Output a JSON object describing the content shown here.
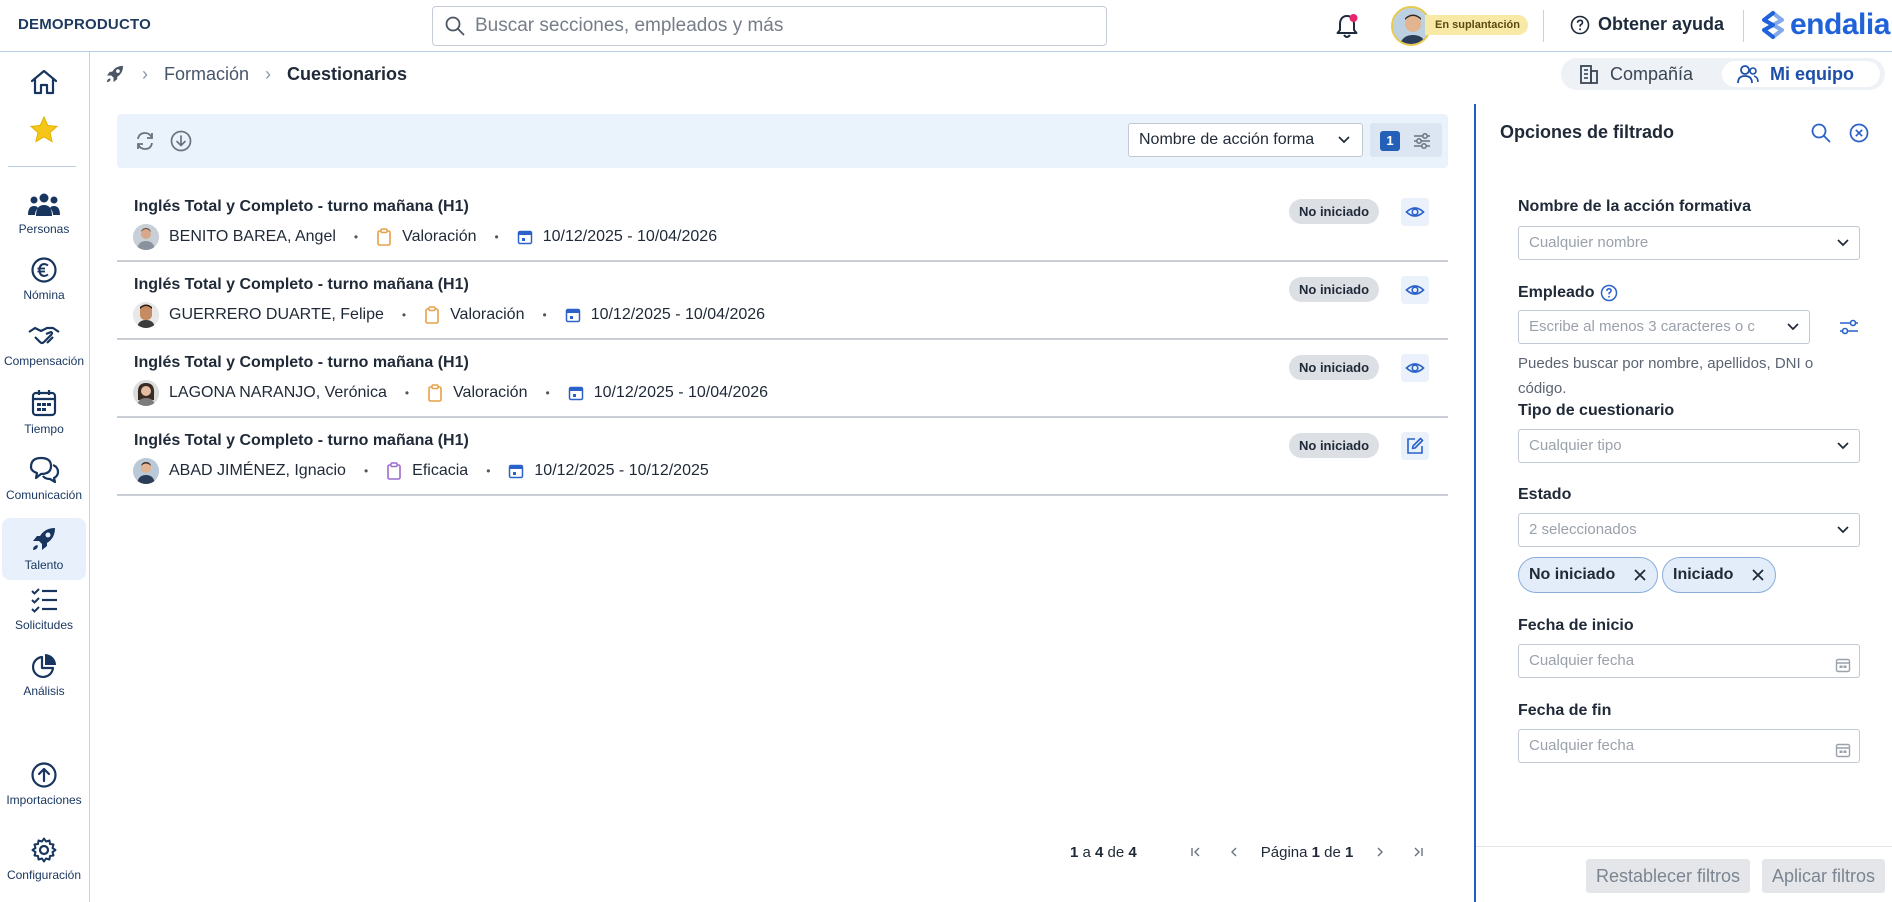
{
  "header": {
    "company": "DEMOPRODUCTO",
    "search_placeholder": "Buscar secciones, empleados y más",
    "impersonation": "En suplantación",
    "help": "Obtener ayuda",
    "logo": "endalia"
  },
  "sidebar": {
    "items": [
      {
        "label": "",
        "icon": "home-icon"
      },
      {
        "label": "",
        "icon": "star-icon"
      },
      {
        "label": "Personas",
        "icon": "people-icon"
      },
      {
        "label": "Nómina",
        "icon": "euro-icon"
      },
      {
        "label": "Compensación",
        "icon": "handshake-icon"
      },
      {
        "label": "Tiempo",
        "icon": "calendar-icon"
      },
      {
        "label": "Comunicación",
        "icon": "chat-icon"
      },
      {
        "label": "Talento",
        "icon": "rocket-icon"
      },
      {
        "label": "Solicitudes",
        "icon": "checklist-icon"
      },
      {
        "label": "Análisis",
        "icon": "pie-chart-icon"
      },
      {
        "label": "Importaciones",
        "icon": "import-icon"
      },
      {
        "label": "Configuración",
        "icon": "gear-icon"
      }
    ]
  },
  "breadcrumb": {
    "items": [
      "Formación",
      "Cuestionarios"
    ]
  },
  "view_switch": {
    "company": "Compañía",
    "team": "Mi equipo"
  },
  "toolbar": {
    "select_label": "Nombre de acción forma",
    "filter_count": "1"
  },
  "rows": [
    {
      "title": "Inglés Total y Completo - turno mañana (H1)",
      "employee": "BENITO BAREA, Angel",
      "type": "Valoración",
      "dates": "10/12/2025 - 10/04/2026",
      "status": "No iniciado",
      "action": "view"
    },
    {
      "title": "Inglés Total y Completo - turno mañana (H1)",
      "employee": "GUERRERO DUARTE, Felipe",
      "type": "Valoración",
      "dates": "10/12/2025 - 10/04/2026",
      "status": "No iniciado",
      "action": "view"
    },
    {
      "title": "Inglés Total y Completo - turno mañana (H1)",
      "employee": "LAGONA NARANJO, Verónica",
      "type": "Valoración",
      "dates": "10/12/2025 - 10/04/2026",
      "status": "No iniciado",
      "action": "view"
    },
    {
      "title": "Inglés Total y Completo - turno mañana (H1)",
      "employee": "ABAD JIMÉNEZ, Ignacio",
      "type": "Eficacia",
      "dates": "10/12/2025 - 10/12/2025",
      "status": "No iniciado",
      "action": "edit"
    }
  ],
  "pager": {
    "from": "1",
    "a": "a",
    "to": "4",
    "de": "de",
    "total": "4",
    "page_word": "Página",
    "page": "1",
    "page_of": "de",
    "pages": "1"
  },
  "filters": {
    "title": "Opciones de filtrado",
    "action_name_label": "Nombre de la acción formativa",
    "action_name_placeholder": "Cualquier nombre",
    "employee_label": "Empleado",
    "employee_placeholder": "Escribe al menos 3 caracteres o c",
    "employee_hint": "Puedes buscar por nombre, apellidos, DNI o código.",
    "type_label": "Tipo de cuestionario",
    "type_placeholder": "Cualquier tipo",
    "status_label": "Estado",
    "status_value": "2 seleccionados",
    "chips": [
      "No iniciado",
      "Iniciado"
    ],
    "start_label": "Fecha de inicio",
    "start_placeholder": "Cualquier fecha",
    "end_label": "Fecha de fin",
    "end_placeholder": "Cualquier fecha",
    "reset": "Restablecer filtros",
    "apply": "Aplicar filtros"
  },
  "colors": {
    "accent": "#1f5fbf",
    "nav_text": "#17355e",
    "valoracion_icon": "#e8a04a",
    "eficacia_icon": "#9b6ccf",
    "calendar_icon": "#2a62c9"
  }
}
